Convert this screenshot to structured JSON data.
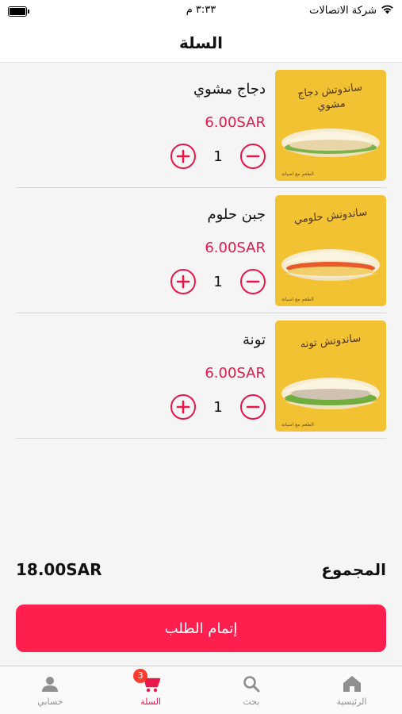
{
  "status_bar": {
    "carrier": "شركة الاتصالات",
    "time": "٣:٣٣ م",
    "icons": [
      "wifi-icon",
      "battery-icon"
    ]
  },
  "header": {
    "title": "السلة"
  },
  "cart": {
    "items": [
      {
        "name": "دجاج مشوي",
        "price": "6.00SAR",
        "quantity": "1",
        "image_label": "ساندوتش دجاج مشوي",
        "image_footer": "الطعم مع اسيانة"
      },
      {
        "name": "جبن حلوم",
        "price": "6.00SAR",
        "quantity": "1",
        "image_label": "ساندوتش حلومي",
        "image_footer": "الطعم مع اسيانة"
      },
      {
        "name": "تونة",
        "price": "6.00SAR",
        "quantity": "1",
        "image_label": "ساندوتش تونه",
        "image_footer": "الطعم مع اسيانة"
      }
    ]
  },
  "summary": {
    "total_label": "المجموع",
    "total_value": "18.00SAR"
  },
  "checkout": {
    "label": "إتمام الطلب"
  },
  "tab_bar": {
    "tabs": [
      {
        "label": "حسابي",
        "icon": "person-icon",
        "active": false
      },
      {
        "label": "السلة",
        "icon": "cart-icon",
        "active": true,
        "badge": "3"
      },
      {
        "label": "بحث",
        "icon": "search-icon",
        "active": false
      },
      {
        "label": "الرئيسية",
        "icon": "home-icon",
        "active": false
      }
    ]
  },
  "colors": {
    "accent": "#e8174a",
    "button": "#ff1f4f",
    "thumb_bg": "#f2c232",
    "badge": "#ff3b30",
    "inactive": "#8f8f8f"
  }
}
